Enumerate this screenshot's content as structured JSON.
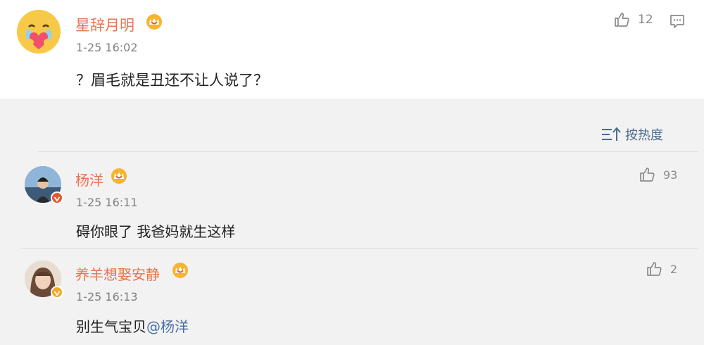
{
  "main_comment": {
    "username": "星辞月明",
    "timestamp": "1-25 16:02",
    "text": "？眉毛就是丑还不让人说了？",
    "like_count": "12",
    "avatar_icon": "crying-heart-emoji-icon"
  },
  "sort": {
    "label": "按热度"
  },
  "replies": [
    {
      "username": "杨洋",
      "timestamp": "1-25 16:11",
      "text": "碍你眼了 我爸妈就生这样",
      "like_count": "93",
      "badge_color": "#e8552f"
    },
    {
      "username": "养羊想娶安静",
      "timestamp": "1-25 16:13",
      "text_prefix": "别生气宝贝",
      "mention": "@杨洋",
      "like_count": "2",
      "badge_color": "#f0a92c"
    }
  ],
  "colors": {
    "username": "#eb7350",
    "sort": "#4a6b8f",
    "mention": "#4a6fa5",
    "panel_bg": "#f2f2f2"
  }
}
